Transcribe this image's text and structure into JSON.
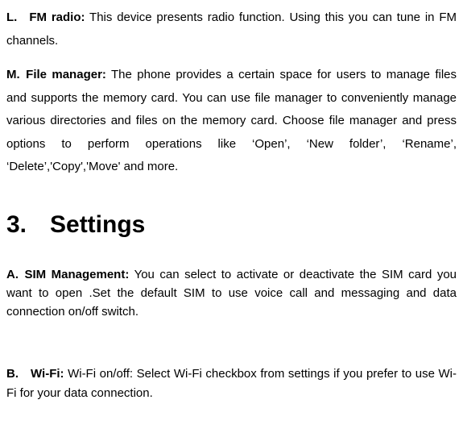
{
  "sectionL": {
    "label": "L. FM radio:",
    "text": " This device presents radio function. Using this you can tune in FM channels."
  },
  "sectionM": {
    "label": "M. File manager:",
    "text": " The phone provides a certain space for users to manage files and supports the memory card. You can use file manager to conveniently manage various directories and files on the memory card. Choose file manager and press options to perform operations like ‘Open’, ‘New folder’, ‘Rename’, ‘Delete’,'Copy','Move' and more."
  },
  "heading": {
    "number": "3.",
    "title": "Settings"
  },
  "sectionA": {
    "label": "A. SIM Management",
    "colon": ":",
    "text": " You can select to activate or deactivate the SIM card you want to open .Set the default SIM to use voice call and messaging and data connection on/off switch."
  },
  "sectionB": {
    "label": "B. Wi-Fi:",
    "text": " Wi-Fi on/off: Select Wi-Fi checkbox from settings if you prefer to use Wi-Fi for your data connection."
  }
}
